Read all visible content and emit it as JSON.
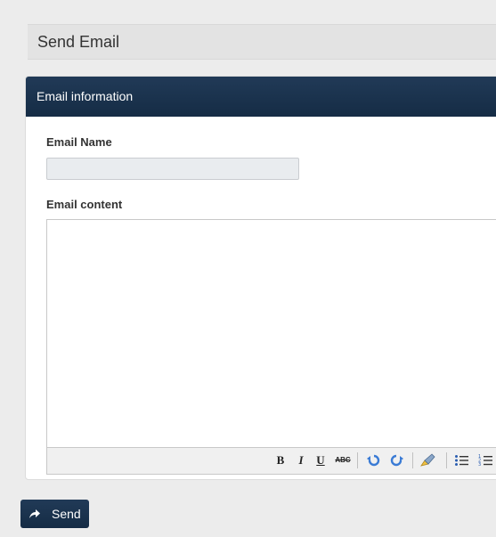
{
  "header": {
    "title": "Send Email"
  },
  "panel": {
    "heading": "Email information",
    "email_name_label": "Email Name",
    "email_name_value": "",
    "email_content_label": "Email content",
    "email_content_value": ""
  },
  "editor_toolbar": {
    "bold": "B",
    "italic": "I",
    "underline": "U",
    "strike": "ABC"
  },
  "actions": {
    "send_label": "Send"
  },
  "colors": {
    "primary": "#1a3350",
    "page_bg": "#ececec"
  },
  "icons": [
    "reply-arrow-icon",
    "undo-icon",
    "redo-icon",
    "eraser-icon",
    "bullet-list-icon",
    "numbered-list-icon"
  ]
}
